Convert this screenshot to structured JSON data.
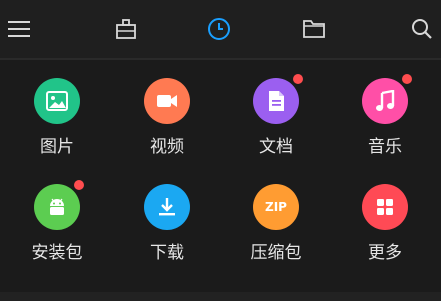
{
  "topbar": {
    "menu_icon": "hamburger-menu-icon",
    "tab_1_icon": "cleaning-bag-icon",
    "tab_2_icon": "clock-icon",
    "tab_3_icon": "folder-icon",
    "search_icon": "search-icon",
    "accent_color": "#1a9fff"
  },
  "categories": [
    {
      "label": "图片",
      "icon": "image-icon",
      "color": "#21c489",
      "badge": false
    },
    {
      "label": "视频",
      "icon": "video-icon",
      "color": "#ff7a52",
      "badge": false
    },
    {
      "label": "文档",
      "icon": "document-icon",
      "color": "#9b5ff0",
      "badge": true
    },
    {
      "label": "音乐",
      "icon": "music-icon",
      "color": "#ff4fa7",
      "badge": true
    },
    {
      "label": "安装包",
      "icon": "android-icon",
      "color": "#5ccd51",
      "badge": true
    },
    {
      "label": "下载",
      "icon": "download-icon",
      "color": "#1ba8f2",
      "badge": false
    },
    {
      "label": "压缩包",
      "icon": "zip-icon",
      "color": "#ff9c32",
      "badge": false,
      "icon_text": "ZIP"
    },
    {
      "label": "更多",
      "icon": "more-grid-icon",
      "color": "#ff4a55",
      "badge": false
    }
  ]
}
